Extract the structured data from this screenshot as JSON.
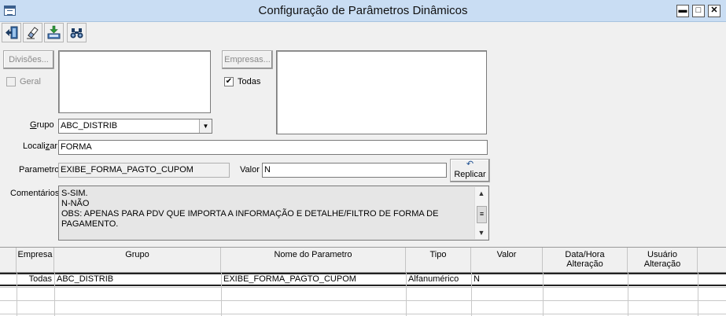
{
  "window": {
    "title": "Configuração de Parâmetros Dinâmicos",
    "app_icon": "table-icon",
    "buttons": {
      "minimize": "▬",
      "maximize": "□",
      "close": "✕"
    }
  },
  "toolbar": [
    {
      "name": "exit-icon"
    },
    {
      "name": "eraser-icon"
    },
    {
      "name": "save-download-icon"
    },
    {
      "name": "binoculars-icon"
    }
  ],
  "form": {
    "divisoes_button": "Divisões...",
    "geral_label": "Geral",
    "geral_checked": false,
    "empresas_button": "Empresas...",
    "todas_label": "Todas",
    "todas_checked": true,
    "grupo_label": "Grupo",
    "grupo_value": "ABC_DISTRIB",
    "localizar_label": "Localizar",
    "localizar_value": "FORMA",
    "parametro_label": "Parametro",
    "parametro_value": "EXIBE_FORMA_PAGTO_CUPOM",
    "valor_label": "Valor",
    "valor_value": "N",
    "replicar_button": "Replicar",
    "comentarios_label": "Comentários",
    "comentarios_text": "S-SIM.\nN-NÃO\nOBS: APENAS PARA PDV QUE IMPORTA A INFORMAÇÃO E DETALHE/FILTRO DE FORMA DE PAGAMENTO."
  },
  "grid": {
    "columns": [
      "Empresa",
      "Grupo",
      "Nome do Parametro",
      "Tipo",
      "Valor",
      "Data/Hora\nAlteração",
      "Usuário\nAlteração"
    ],
    "rows": [
      [
        "Todas",
        "ABC_DISTRIB",
        "EXIBE_FORMA_PAGTO_CUPOM",
        "Alfanumérico",
        "N",
        "",
        ""
      ]
    ]
  }
}
